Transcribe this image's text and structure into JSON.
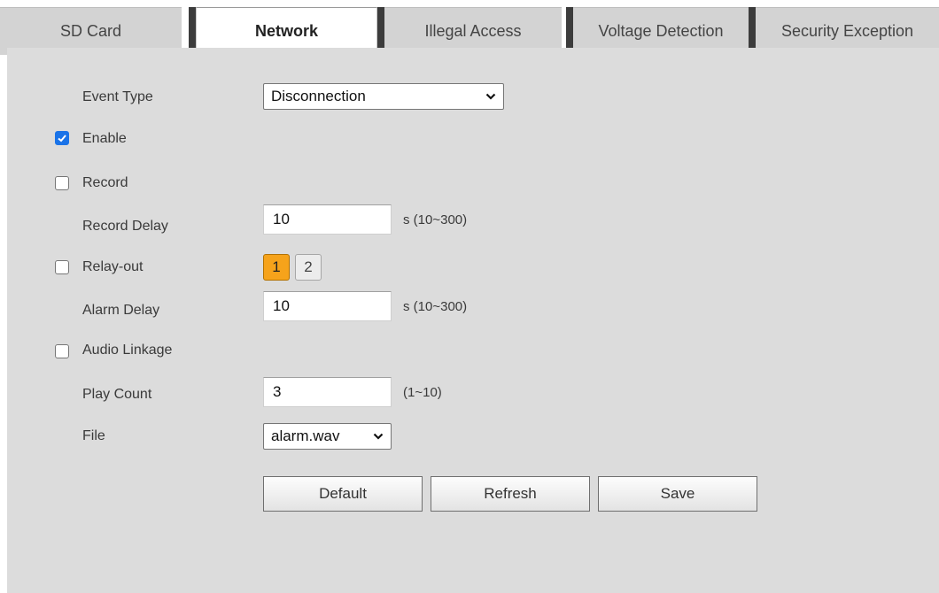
{
  "tabs": [
    {
      "label": "SD Card",
      "active": false
    },
    {
      "label": "Network",
      "active": true
    },
    {
      "label": "Illegal Access",
      "active": false
    },
    {
      "label": "Voltage Detection",
      "active": false
    },
    {
      "label": "Security Exception",
      "active": false
    }
  ],
  "form": {
    "event_type": {
      "label": "Event Type",
      "value": "Disconnection",
      "icon": "chevron-down-icon"
    },
    "enable": {
      "label": "Enable",
      "checked": true
    },
    "record": {
      "label": "Record",
      "checked": false
    },
    "record_delay": {
      "label": "Record Delay",
      "value": "10",
      "unit": "s (10~300)"
    },
    "relay_out": {
      "label": "Relay-out",
      "checked": false,
      "channels": [
        "1",
        "2"
      ],
      "selected": "1"
    },
    "alarm_delay": {
      "label": "Alarm Delay",
      "value": "10",
      "unit": "s (10~300)"
    },
    "audio_linkage": {
      "label": "Audio Linkage",
      "checked": false
    },
    "play_count": {
      "label": "Play Count",
      "value": "3",
      "unit": "(1~10)"
    },
    "file": {
      "label": "File",
      "value": "alarm.wav"
    }
  },
  "buttons": {
    "default_label": "Default",
    "refresh_label": "Refresh",
    "save_label": "Save"
  },
  "colors": {
    "panel_bg": "#dcdcdc",
    "tab_bg": "#d3d3d3",
    "checkbox_checked": "#1a73e8",
    "relay_active": "#f6a31b"
  }
}
